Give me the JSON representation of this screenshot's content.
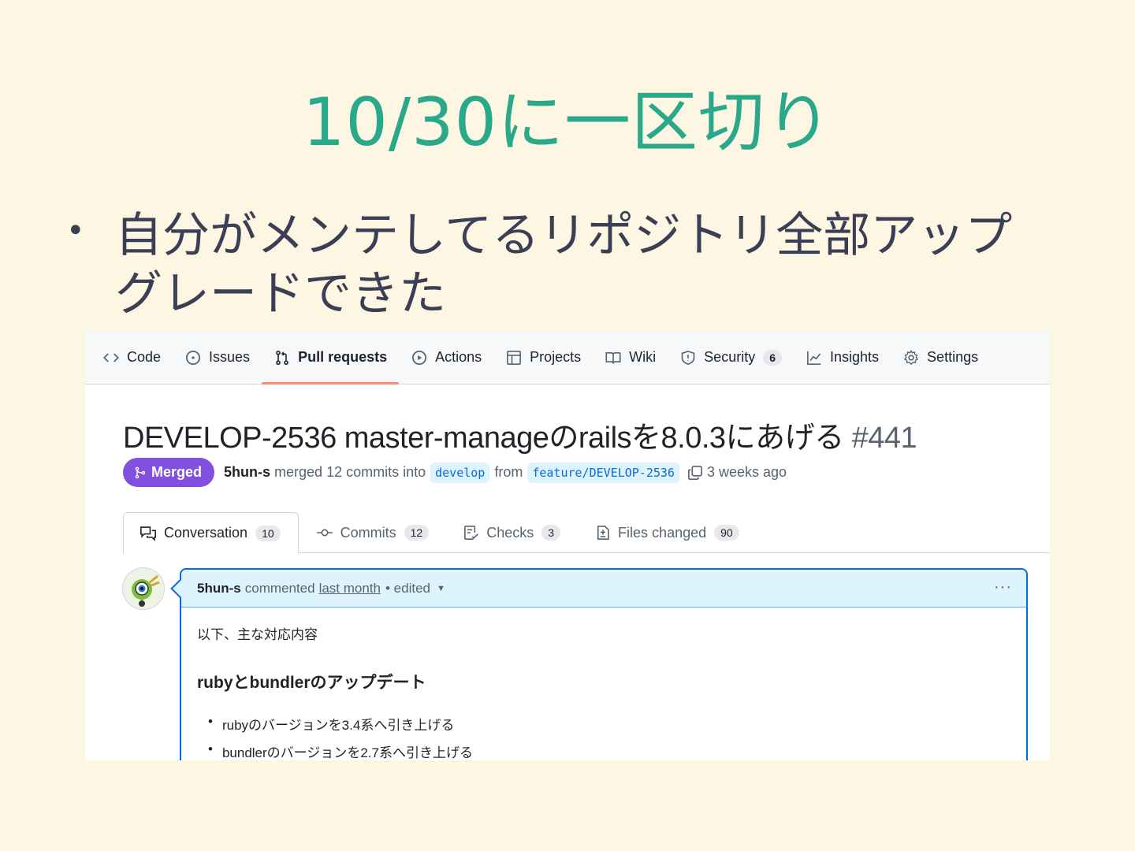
{
  "slide": {
    "title": "10/30に一区切り",
    "bullet": "自分がメンテしてるリポジトリ全部アップグレードできた"
  },
  "repo_nav": {
    "items": [
      {
        "label": "Code",
        "icon": "code-icon"
      },
      {
        "label": "Issues",
        "icon": "issue-icon"
      },
      {
        "label": "Pull requests",
        "icon": "pull-request-icon",
        "active": true
      },
      {
        "label": "Actions",
        "icon": "play-icon"
      },
      {
        "label": "Projects",
        "icon": "table-icon"
      },
      {
        "label": "Wiki",
        "icon": "book-icon"
      },
      {
        "label": "Security",
        "icon": "shield-icon",
        "count": "6"
      },
      {
        "label": "Insights",
        "icon": "graph-icon"
      },
      {
        "label": "Settings",
        "icon": "gear-icon"
      }
    ]
  },
  "pr": {
    "title": "DEVELOP-2536 master-manageのrailsを8.0.3にあげる",
    "number": "#441",
    "state": "Merged",
    "author": "5hun-s",
    "merge_text": "merged 12 commits into",
    "base_branch": "develop",
    "from_text": "from",
    "head_branch": "feature/DEVELOP-2536",
    "time": "3 weeks ago"
  },
  "tabs": [
    {
      "label": "Conversation",
      "count": "10",
      "icon": "comment-discussion-icon"
    },
    {
      "label": "Commits",
      "count": "12",
      "icon": "commit-icon"
    },
    {
      "label": "Checks",
      "count": "3",
      "icon": "checklist-icon"
    },
    {
      "label": "Files changed",
      "count": "90",
      "icon": "file-diff-icon"
    }
  ],
  "comment": {
    "author": "5hun-s",
    "action": "commented",
    "time": "last month",
    "edited": "• edited",
    "kebab": "···",
    "intro": "以下、主な対応内容",
    "heading": "rubyとbundlerのアップデート",
    "items": [
      "rubyのバージョンを3.4系へ引き上げる",
      "bundlerのバージョンを2.7系へ引き上げる"
    ]
  },
  "colors": {
    "title": "#2aa88a",
    "merged": "#8250df",
    "accent": "#0969da",
    "active_tab_underline": "#fd8c73"
  }
}
